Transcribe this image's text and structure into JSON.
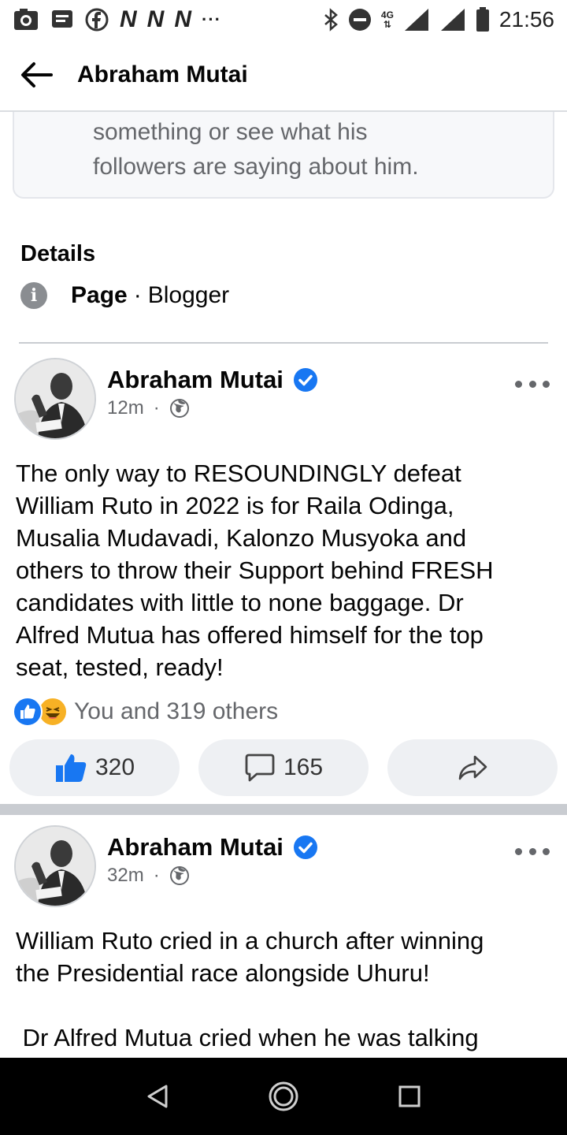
{
  "status_bar": {
    "network_type": "4G",
    "time": "21:56",
    "overflow": "···",
    "notif_letters": [
      "N",
      "N",
      "N"
    ]
  },
  "header": {
    "title": "Abraham Mutai"
  },
  "about": {
    "text_line1": "something or see what his",
    "text_line2": "followers are saying about him."
  },
  "details": {
    "title": "Details",
    "page_label": "Page",
    "separator": "·",
    "category": "Blogger"
  },
  "posts": [
    {
      "author": "Abraham Mutai",
      "time": "12m",
      "dot": "·",
      "text_lines": [
        "The only way to RESOUNDINGLY defeat",
        "William Ruto in 2022 is for Raila Odinga,",
        "Musalia Mudavadi, Kalonzo Musyoka and",
        "others to throw their Support behind FRESH",
        "candidates with little to none baggage. Dr",
        "Alfred Mutua has offered himself for the top",
        "seat, tested, ready!"
      ],
      "reactions_text": "You and 319 others",
      "like_count": "320",
      "comment_count": "165"
    },
    {
      "author": "Abraham Mutai",
      "time": "32m",
      "dot": "·",
      "text_lines": [
        "William Ruto cried in a church after winning",
        "the Presidential race alongside Uhuru!",
        "",
        " Dr Alfred Mutua cried when he was talking"
      ]
    }
  ],
  "colors": {
    "accent": "#1877f2",
    "secondary_text": "#65676b",
    "divider": "#c9ccd1",
    "button_bg": "#eef0f3"
  }
}
